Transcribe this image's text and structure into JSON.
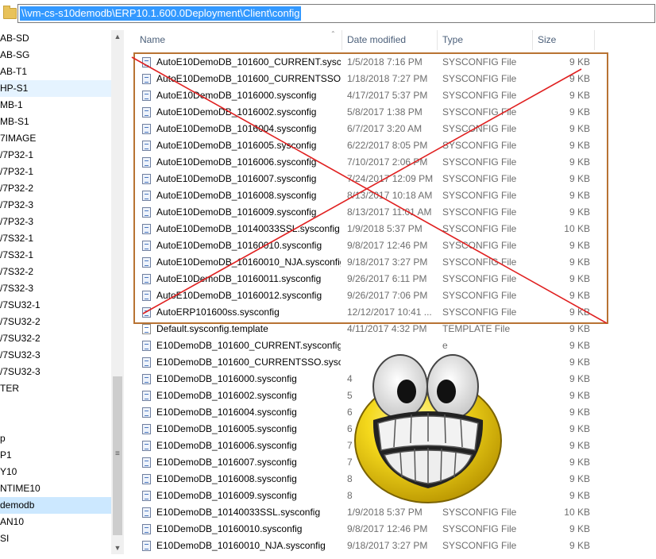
{
  "address": {
    "path": "\\\\vm-cs-s10demodb\\ERP10.1.600.0Deployment\\Client\\config"
  },
  "nav": {
    "items": [
      {
        "label": "AB-SD",
        "state": ""
      },
      {
        "label": "AB-SG",
        "state": ""
      },
      {
        "label": "AB-T1",
        "state": ""
      },
      {
        "label": "HP-S1",
        "state": "hl"
      },
      {
        "label": "MB-1",
        "state": ""
      },
      {
        "label": "MB-S1",
        "state": ""
      },
      {
        "label": "7IMAGE",
        "state": ""
      },
      {
        "label": "/7P32-1",
        "state": ""
      },
      {
        "label": "/7P32-1",
        "state": ""
      },
      {
        "label": "/7P32-2",
        "state": ""
      },
      {
        "label": "/7P32-3",
        "state": ""
      },
      {
        "label": "/7P32-3",
        "state": ""
      },
      {
        "label": "/7S32-1",
        "state": ""
      },
      {
        "label": "/7S32-1",
        "state": ""
      },
      {
        "label": "/7S32-2",
        "state": ""
      },
      {
        "label": "/7S32-3",
        "state": ""
      },
      {
        "label": "/7SU32-1",
        "state": ""
      },
      {
        "label": "/7SU32-2",
        "state": ""
      },
      {
        "label": "/7SU32-2",
        "state": ""
      },
      {
        "label": "/7SU32-3",
        "state": ""
      },
      {
        "label": "/7SU32-3",
        "state": ""
      },
      {
        "label": "TER",
        "state": ""
      },
      {
        "label": "",
        "state": ""
      },
      {
        "label": "",
        "state": ""
      },
      {
        "label": "p",
        "state": ""
      },
      {
        "label": "P1",
        "state": ""
      },
      {
        "label": "Y10",
        "state": ""
      },
      {
        "label": "NTIME10",
        "state": ""
      },
      {
        "label": "demodb",
        "state": "sel"
      },
      {
        "label": "AN10",
        "state": ""
      },
      {
        "label": "SI",
        "state": ""
      }
    ]
  },
  "columns": {
    "name": "Name",
    "date": "Date modified",
    "type": "Type",
    "size": "Size"
  },
  "files": [
    {
      "name": "AutoE10DemoDB_101600_CURRENT.sysc...",
      "date": "1/5/2018 7:16 PM",
      "type": "SYSCONFIG File",
      "size": "9 KB",
      "icon": "sysconfig"
    },
    {
      "name": "AutoE10DemoDB_101600_CURRENTSSO....",
      "date": "1/18/2018 7:27 PM",
      "type": "SYSCONFIG File",
      "size": "9 KB",
      "icon": "sysconfig"
    },
    {
      "name": "AutoE10DemoDB_1016000.sysconfig",
      "date": "4/17/2017 5:37 PM",
      "type": "SYSCONFIG File",
      "size": "9 KB",
      "icon": "sysconfig"
    },
    {
      "name": "AutoE10DemoDB_1016002.sysconfig",
      "date": "5/8/2017 1:38 PM",
      "type": "SYSCONFIG File",
      "size": "9 KB",
      "icon": "sysconfig"
    },
    {
      "name": "AutoE10DemoDB_1016004.sysconfig",
      "date": "6/7/2017 3:20 AM",
      "type": "SYSCONFIG File",
      "size": "9 KB",
      "icon": "sysconfig"
    },
    {
      "name": "AutoE10DemoDB_1016005.sysconfig",
      "date": "6/22/2017 8:05 PM",
      "type": "SYSCONFIG File",
      "size": "9 KB",
      "icon": "sysconfig"
    },
    {
      "name": "AutoE10DemoDB_1016006.sysconfig",
      "date": "7/10/2017 2:06 PM",
      "type": "SYSCONFIG File",
      "size": "9 KB",
      "icon": "sysconfig"
    },
    {
      "name": "AutoE10DemoDB_1016007.sysconfig",
      "date": "7/24/2017 12:09 PM",
      "type": "SYSCONFIG File",
      "size": "9 KB",
      "icon": "sysconfig"
    },
    {
      "name": "AutoE10DemoDB_1016008.sysconfig",
      "date": "8/13/2017 10:18 AM",
      "type": "SYSCONFIG File",
      "size": "9 KB",
      "icon": "sysconfig"
    },
    {
      "name": "AutoE10DemoDB_1016009.sysconfig",
      "date": "8/13/2017 11:01 AM",
      "type": "SYSCONFIG File",
      "size": "9 KB",
      "icon": "sysconfig"
    },
    {
      "name": "AutoE10DemoDB_10140033SSL.sysconfig",
      "date": "1/9/2018 5:37 PM",
      "type": "SYSCONFIG File",
      "size": "10 KB",
      "icon": "sysconfig"
    },
    {
      "name": "AutoE10DemoDB_10160010.sysconfig",
      "date": "9/8/2017 12:46 PM",
      "type": "SYSCONFIG File",
      "size": "9 KB",
      "icon": "sysconfig"
    },
    {
      "name": "AutoE10DemoDB_10160010_NJA.sysconfig",
      "date": "9/18/2017 3:27 PM",
      "type": "SYSCONFIG File",
      "size": "9 KB",
      "icon": "sysconfig"
    },
    {
      "name": "AutoE10DemoDB_10160011.sysconfig",
      "date": "9/26/2017 6:11 PM",
      "type": "SYSCONFIG File",
      "size": "9 KB",
      "icon": "sysconfig"
    },
    {
      "name": "AutoE10DemoDB_10160012.sysconfig",
      "date": "9/26/2017 7:06 PM",
      "type": "SYSCONFIG File",
      "size": "9 KB",
      "icon": "sysconfig"
    },
    {
      "name": "AutoERP101600ss.sysconfig",
      "date": "12/12/2017 10:41 ...",
      "type": "SYSCONFIG File",
      "size": "9 KB",
      "icon": "sysconfig"
    },
    {
      "name": "Default.sysconfig.template",
      "date": "4/11/2017 4:32 PM",
      "type": "TEMPLATE File",
      "size": "9 KB",
      "icon": "template"
    },
    {
      "name": "E10DemoDB_101600_CURRENT.sysconfig",
      "date": "",
      "type": "e",
      "size": "9 KB",
      "icon": "sysconfig"
    },
    {
      "name": "E10DemoDB_101600_CURRENTSSO.sysco...",
      "date": "",
      "type": "e",
      "size": "9 KB",
      "icon": "sysconfig"
    },
    {
      "name": "E10DemoDB_1016000.sysconfig",
      "date": "4",
      "type": "e",
      "size": "9 KB",
      "icon": "sysconfig"
    },
    {
      "name": "E10DemoDB_1016002.sysconfig",
      "date": "5",
      "type": "e",
      "size": "9 KB",
      "icon": "sysconfig"
    },
    {
      "name": "E10DemoDB_1016004.sysconfig",
      "date": "6",
      "type": "e",
      "size": "9 KB",
      "icon": "sysconfig"
    },
    {
      "name": "E10DemoDB_1016005.sysconfig",
      "date": "6",
      "type": "e",
      "size": "9 KB",
      "icon": "sysconfig"
    },
    {
      "name": "E10DemoDB_1016006.sysconfig",
      "date": "7",
      "type": "e",
      "size": "9 KB",
      "icon": "sysconfig"
    },
    {
      "name": "E10DemoDB_1016007.sysconfig",
      "date": "7",
      "type": "e",
      "size": "9 KB",
      "icon": "sysconfig"
    },
    {
      "name": "E10DemoDB_1016008.sysconfig",
      "date": "8",
      "type": "e",
      "size": "9 KB",
      "icon": "sysconfig"
    },
    {
      "name": "E10DemoDB_1016009.sysconfig",
      "date": "8",
      "type": "e",
      "size": "9 KB",
      "icon": "sysconfig"
    },
    {
      "name": "E10DemoDB_10140033SSL.sysconfig",
      "date": "1/9/2018 5:37 PM",
      "type": "SYSCONFIG File",
      "size": "10 KB",
      "icon": "sysconfig"
    },
    {
      "name": "E10DemoDB_10160010.sysconfig",
      "date": "9/8/2017 12:46 PM",
      "type": "SYSCONFIG File",
      "size": "9 KB",
      "icon": "sysconfig"
    },
    {
      "name": "E10DemoDB_10160010_NJA.sysconfig",
      "date": "9/18/2017 3:27 PM",
      "type": "SYSCONFIG File",
      "size": "9 KB",
      "icon": "sysconfig"
    }
  ],
  "colors": {
    "selection": "#3399ff",
    "nav_selected": "#cce8ff",
    "annotation_box": "#b87333",
    "annotation_cross": "#e02020",
    "smiley": "#f2d21a"
  }
}
